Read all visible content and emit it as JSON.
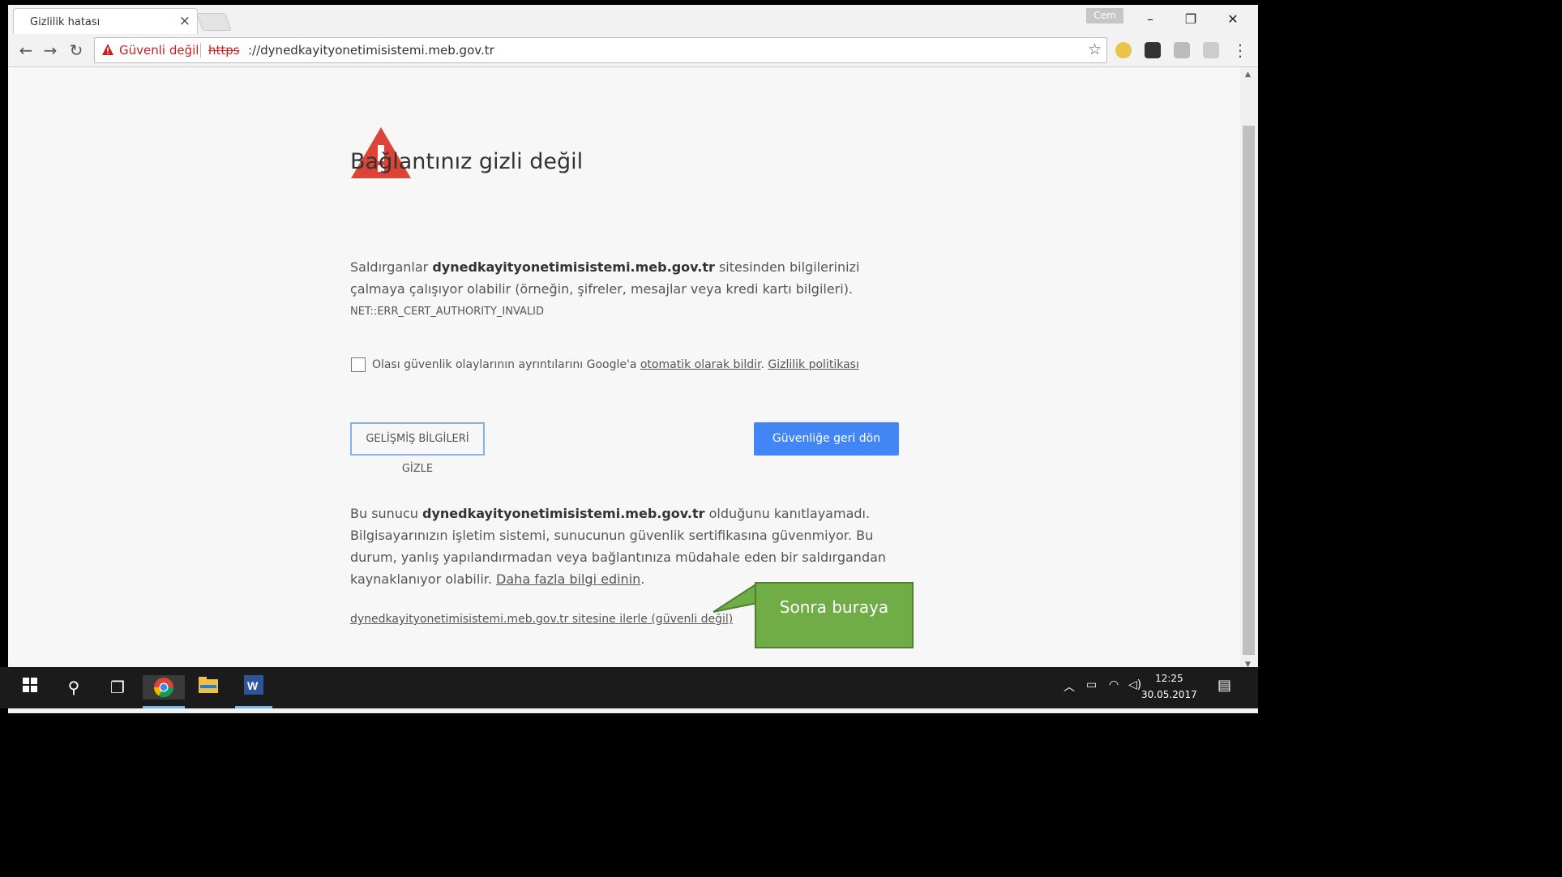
{
  "browser": {
    "tab_title": "Gizlilik hatası",
    "tab_close": "×",
    "profile_name": "Cem",
    "security_label": "Güvenli değil",
    "url_scheme": "https",
    "url_rest": "://dynedkayityonetimisistemi.meb.gov.tr",
    "window_controls": {
      "minimize": "–",
      "restore": "❐",
      "close": "✕"
    }
  },
  "page": {
    "heading": "Bağlantınız gizli değil",
    "intro_pre": "Saldırganlar ",
    "intro_host": "dynedkayityonetimisistemi.meb.gov.tr",
    "intro_post": " sitesinden bilgilerinizi çalmaya çalışıyor olabilir (örneğin, şifreler, mesajlar veya kredi kartı bilgileri).",
    "error_code": "NET::ERR_CERT_AUTHORITY_INVALID",
    "checkbox_text_pre": "Olası güvenlik olaylarının ayrıntılarını Google'a ",
    "checkbox_link1": "otomatik olarak bildir",
    "checkbox_sep": ". ",
    "checkbox_link2": "Gizlilik politikası",
    "advanced_button": "GELİŞMİŞ BİLGİLERİ GİZLE",
    "back_button": "Güvenliğe geri dön",
    "detail_pre": "Bu sunucu ",
    "detail_host": "dynedkayityonetimisistemi.meb.gov.tr",
    "detail_post": " olduğunu kanıtlayamadı. Bilgisayarınızın işletim sistemi, sunucunun güvenlik sertifikasına güvenmiyor. Bu durum, yanlış yapılandırmadan veya bağlantınıza müdahale eden bir saldırgandan kaynaklanıyor olabilir. ",
    "learn_more": "Daha fazla bilgi edinin",
    "learn_more_end": ".",
    "proceed_link": "dynedkayityonetimisistemi.meb.gov.tr sitesine ilerle (güvenli değil)"
  },
  "annotation": {
    "callout_text": "Sonra buraya",
    "callout_color": "#70ad47"
  },
  "taskbar": {
    "time": "12:25",
    "date": "30.05.2017",
    "icons": [
      "windows-start-icon",
      "search-icon",
      "task-view-icon",
      "chrome-icon",
      "file-explorer-icon",
      "word-icon"
    ]
  },
  "colors": {
    "warning_red": "#db4437",
    "button_blue": "#4285f4",
    "insecure_red": "#c5221f"
  }
}
